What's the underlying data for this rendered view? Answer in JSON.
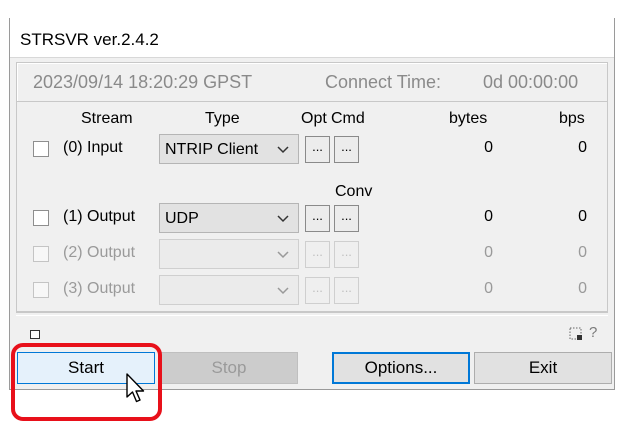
{
  "window": {
    "title": "STRSVR ver.2.4.2"
  },
  "status": {
    "datetime": "2023/09/14 18:20:29 GPST",
    "connect_label": "Connect Time:",
    "connect_value": "0d 00:00:00"
  },
  "headers": {
    "stream": "Stream",
    "type": "Type",
    "opt": "Opt",
    "cmd": "Cmd",
    "conv": "Conv",
    "bytes": "bytes",
    "bps": "bps"
  },
  "streams": [
    {
      "label": "(0) Input",
      "type": "NTRIP Client",
      "opt_btn": "...",
      "cmd_btn": "...",
      "bytes": "0",
      "bps": "0",
      "enabled": true
    },
    {
      "label": "(1) Output",
      "type": "UDP",
      "opt_btn": "...",
      "cmd_btn": "...",
      "bytes": "0",
      "bps": "0",
      "enabled": true
    },
    {
      "label": "(2) Output",
      "type": "",
      "opt_btn": "...",
      "cmd_btn": "...",
      "bytes": "0",
      "bps": "0",
      "enabled": false
    },
    {
      "label": "(3) Output",
      "type": "",
      "opt_btn": "...",
      "cmd_btn": "...",
      "bytes": "0",
      "bps": "0",
      "enabled": false
    }
  ],
  "footer": {
    "help": "?"
  },
  "buttons": {
    "start": "Start",
    "stop": "Stop",
    "options": "Options...",
    "exit": "Exit"
  },
  "colors": {
    "highlight": "#e8101a",
    "accent": "#0078d7"
  },
  "icons": [
    "tray-icon",
    "chevron-down-icon",
    "size-grip-icon",
    "help-icon",
    "mouse-cursor-icon"
  ]
}
